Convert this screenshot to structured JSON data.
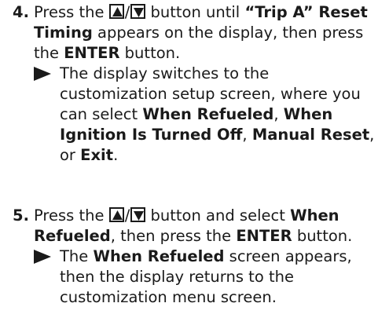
{
  "steps": [
    {
      "number": "4.",
      "text_before_buttons": "Press the ",
      "button_up_icon": "up-triangle-button",
      "slash": "/",
      "button_down_icon": "down-triangle-button",
      "text_after_buttons": " button until ",
      "bold_1": "“Trip A” Reset Timing",
      "text_2": " appears on the display, then press the ",
      "bold_2": "ENTER",
      "text_3": " button.",
      "result": {
        "arrow_icon": "right-arrow-icon",
        "text_1": "The display switches to the customization setup screen, where you can select ",
        "bold_1": "When Refueled",
        "text_2": ", ",
        "bold_2": "When Ignition Is Turned Off",
        "text_3": ", ",
        "bold_3": "Manual Reset",
        "text_4": ", or ",
        "bold_4": "Exit",
        "text_5": "."
      }
    },
    {
      "number": "5.",
      "text_before_buttons": "Press the ",
      "button_up_icon": "up-triangle-button",
      "slash": "/",
      "button_down_icon": "down-triangle-button",
      "text_after_buttons": " button and select ",
      "bold_1": "When Refueled",
      "text_2": ", then press the ",
      "bold_2": "ENTER",
      "text_3": " button.",
      "result": {
        "arrow_icon": "right-arrow-icon",
        "text_1": "The ",
        "bold_1": "When Refueled",
        "text_2": " screen appears, then the display returns to the customization menu screen."
      }
    }
  ]
}
